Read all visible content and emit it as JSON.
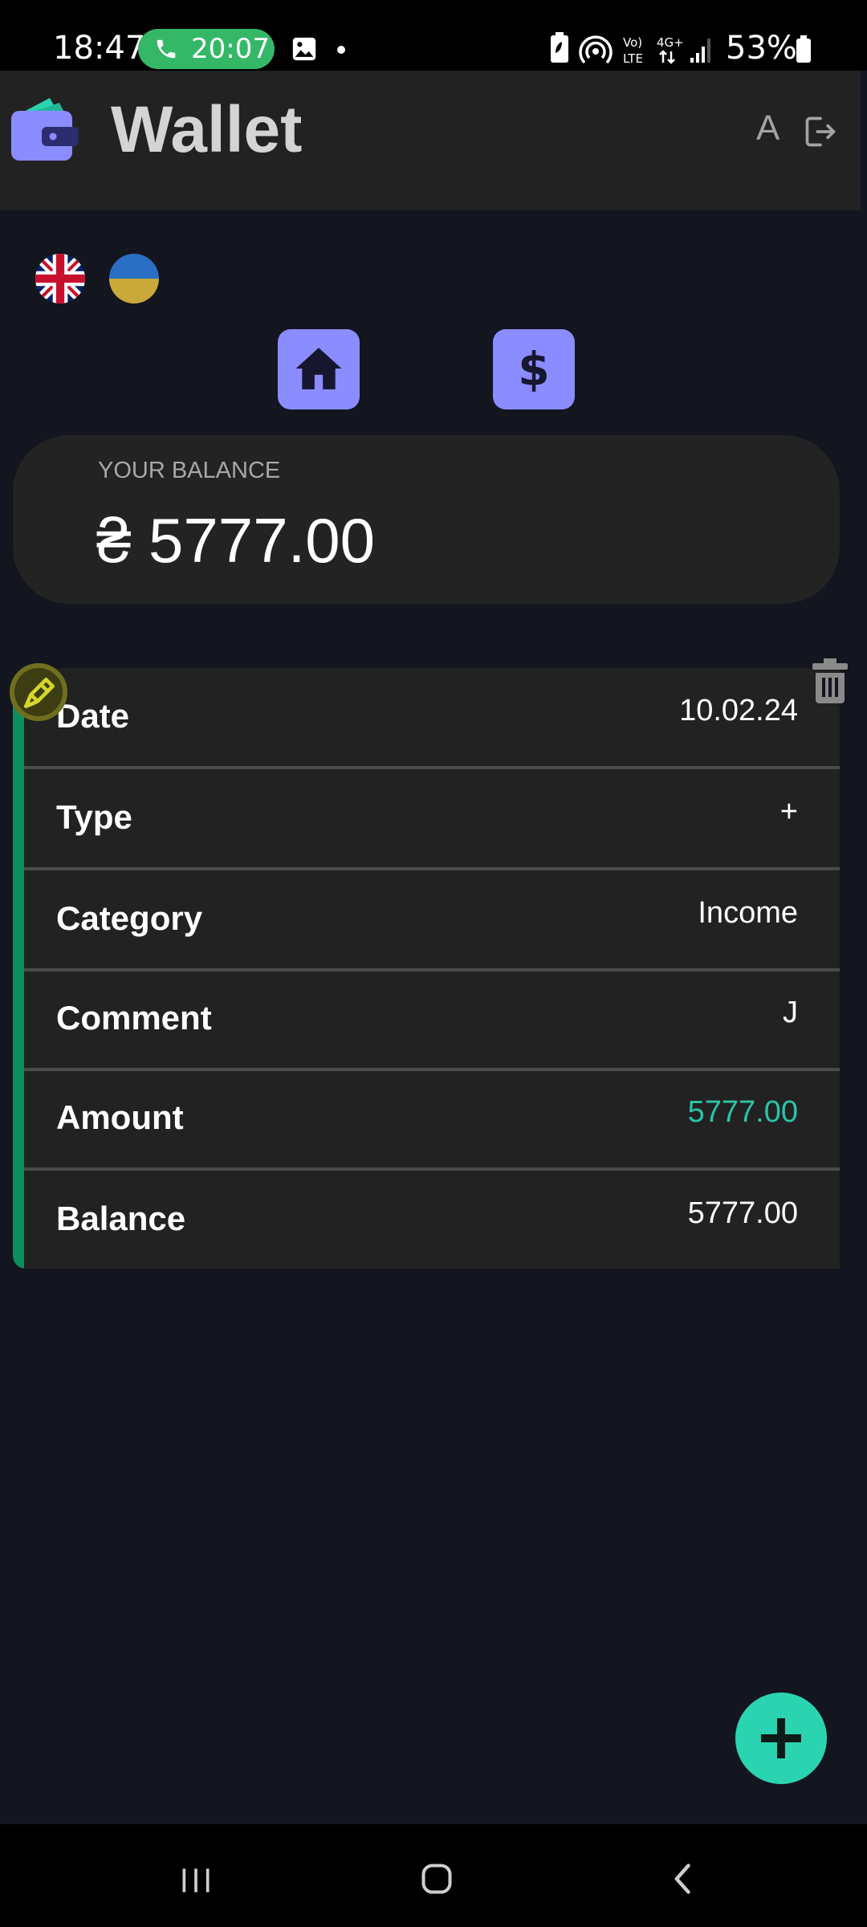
{
  "status_bar": {
    "time": "18:47",
    "call_timer": "20:07",
    "battery": "53%",
    "icons": [
      "phone-icon",
      "gallery-icon",
      "battery-saver-icon",
      "hotspot-icon",
      "volte-icon",
      "4g-icon",
      "signal-icon",
      "battery-icon"
    ]
  },
  "header": {
    "title": "Wallet",
    "icons": [
      "wallet-logo",
      "font-size-icon",
      "logout-icon"
    ],
    "font_icon_glyph": "A"
  },
  "languages": [
    "english-flag",
    "ukrainian-flag"
  ],
  "nav": {
    "buttons": [
      "home-icon",
      "dollar-icon"
    ]
  },
  "balance": {
    "label": "YOUR BALANCE",
    "value": "₴ 5777.00"
  },
  "transaction": {
    "rows": [
      {
        "label": "Date",
        "value": "10.02.24"
      },
      {
        "label": "Type",
        "value": "+"
      },
      {
        "label": "Category",
        "value": "Income"
      },
      {
        "label": "Comment",
        "value": "J"
      },
      {
        "label": "Amount",
        "value": "5777.00"
      },
      {
        "label": "Balance",
        "value": "5777.00"
      }
    ],
    "icons": [
      "edit-icon",
      "trash-icon"
    ]
  },
  "fab": {
    "icon": "plus-icon"
  },
  "system_nav": {
    "icons": [
      "recent-apps-icon",
      "home-button-icon",
      "back-icon"
    ]
  },
  "colors": {
    "background": "#13151f",
    "header": "#222222",
    "accent_purple": "#8a8cff",
    "accent_teal": "#2ad4b1",
    "income_green": "#0b8f5e",
    "amount_text": "#2bc5a8",
    "call_pill": "#35b768"
  }
}
